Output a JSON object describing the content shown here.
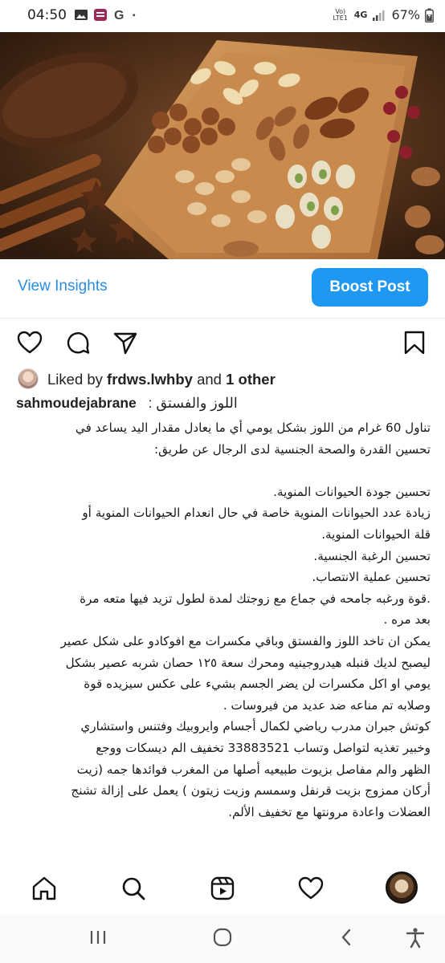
{
  "status_bar": {
    "time": "04:50",
    "left_icons": [
      "image-icon",
      "app-icon",
      "google-icon",
      "dot-icon"
    ],
    "network": "4G",
    "carrier_small": "Vo) LTE1",
    "battery_percent": "67%"
  },
  "post": {
    "image_alt": "nuts",
    "view_insights": "View Insights",
    "boost_post": "Boost Post",
    "liked_by_prefix": "Liked by",
    "liked_by_user": "frdws.lwhby",
    "liked_by_and": "and",
    "liked_by_other": "1 other",
    "caption_user": "sahmoudejabrane",
    "caption_title": ": اللوز والفستق",
    "caption_lines": [
      "تناول 60 غرام من اللوز بشكل يومي أي ما يعادل مقدار اليد يساعد في",
      "تحسين القدرة والصحة الجنسية لدى الرجال عن طريق:",
      "",
      "تحسين جودة الحيوانات المنوية.",
      "زيادة عدد الحيوانات المنوية خاصة في حال انعدام الحيوانات المنوية أو",
      "قلة الحيوانات المنوية.",
      "تحسين الرغبة الجنسية.",
      "تحسين عملية الانتصاب.",
      ".قوة ورغبه جامحه في جماع مع زوجتك لمدة لطول تزيد فيها متعه مرة",
      "بعد مره .",
      "يمكن ان تاخد اللوز والفستق وباقي مكسرات مع افوكادو على شكل عصير",
      "ليصبح لديك قنبله هيدروجينيه ومحرك سعة ١٢٥ حصان شربه عصير بشكل",
      "يومي او اكل مكسرات لن يضر الجسم بشيء على عكس سيزيده قوة",
      "وصلابه تم مناعه ضد عديد من فيروسات .",
      "كوتش جبران مدرب رياضي لكمال أجسام وايروبيك وفتنس واستشاري",
      "وخبير تغذيه لتواصل وتساب 33883521  تخفيف الم ديسكات ووجع",
      "الظهر والم مفاصل بزيوت طبيعيه أصلها من المغرب فوائدها جمه (زيت",
      "أركان ممزوج بزيت قرنفل وسمسم وزيت زيتون ) يعمل على إزالة تشنج",
      "العضلات واعادة مرونتها مع تخفيف الألم."
    ]
  },
  "actions": [
    "heart-icon",
    "comment-icon",
    "share-icon",
    "bookmark-icon"
  ],
  "bottom_nav": [
    "home-icon",
    "search-icon",
    "reels-icon",
    "activity-heart-icon",
    "profile-avatar"
  ],
  "system_nav": [
    "recents-icon",
    "home-circle-icon",
    "back-icon",
    "accessibility-icon"
  ],
  "colors": {
    "accent": "#1f98f3",
    "link": "#2b8de0"
  }
}
